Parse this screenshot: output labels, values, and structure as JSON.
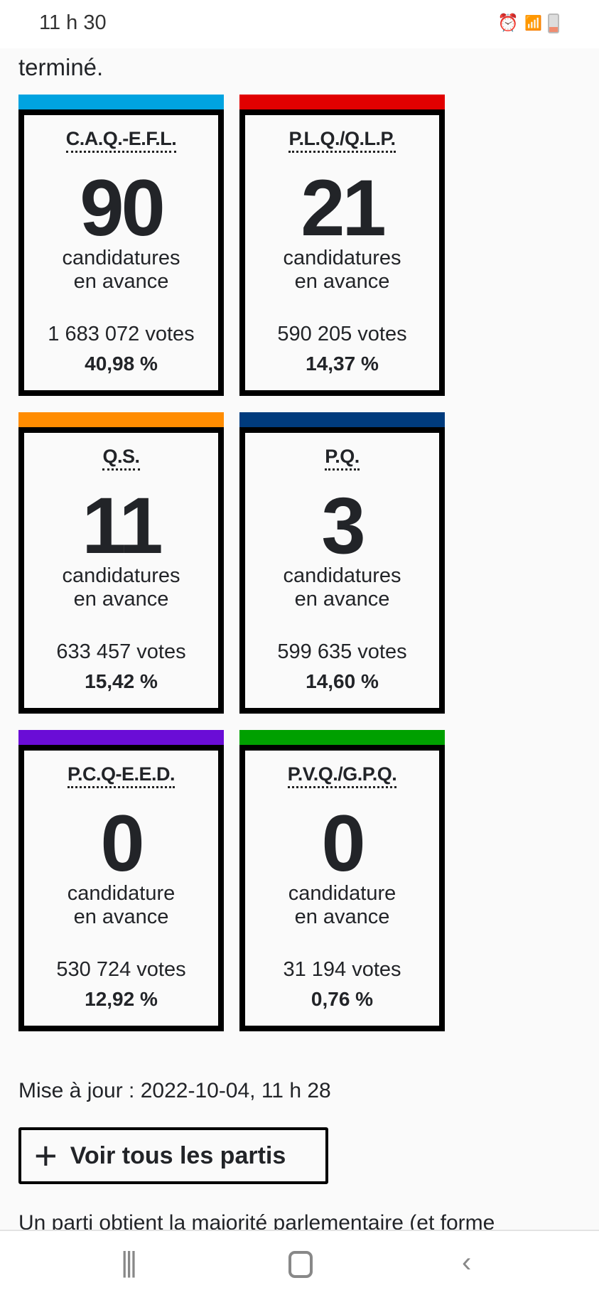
{
  "status_bar": {
    "time": "11 h 30",
    "icons": [
      "alarm-icon",
      "wifi-icon",
      "signal-icon",
      "battery-icon"
    ]
  },
  "intro_text": "terminé.",
  "parties": [
    {
      "abbr": "C.A.Q.-E.F.L.",
      "seats": "90",
      "label1": "candidatures",
      "label2": "en avance",
      "votes": "1 683 072 votes",
      "pct": "40,98 %",
      "color": "#00a3e0"
    },
    {
      "abbr": "P.L.Q./Q.L.P.",
      "seats": "21",
      "label1": "candidatures",
      "label2": "en avance",
      "votes": "590 205 votes",
      "pct": "14,37 %",
      "color": "#e10000"
    },
    {
      "abbr": "Q.S.",
      "seats": "11",
      "label1": "candidatures",
      "label2": "en avance",
      "votes": "633 457 votes",
      "pct": "15,42 %",
      "color": "#ff8c00"
    },
    {
      "abbr": "P.Q.",
      "seats": "3",
      "label1": "candidatures",
      "label2": "en avance",
      "votes": "599 635 votes",
      "pct": "14,60 %",
      "color": "#003b7d"
    },
    {
      "abbr": "P.C.Q-E.E.D.",
      "seats": "0",
      "label1": "candidature",
      "label2": "en avance",
      "votes": "530 724 votes",
      "pct": "12,92 %",
      "color": "#6a0dd6"
    },
    {
      "abbr": "P.V.Q./G.P.Q.",
      "seats": "0",
      "label1": "candidature",
      "label2": "en avance",
      "votes": "31 194 votes",
      "pct": "0,76 %",
      "color": "#00a000"
    }
  ],
  "updated": "Mise à jour : 2022-10-04, 11 h 28",
  "see_all_button": "Voir tous les partis",
  "bottom_text": "Un parti obtient la majorité parlementaire (et forme",
  "nav": {
    "recent": "recent-apps-icon",
    "home": "home-icon",
    "back": "back-icon"
  }
}
